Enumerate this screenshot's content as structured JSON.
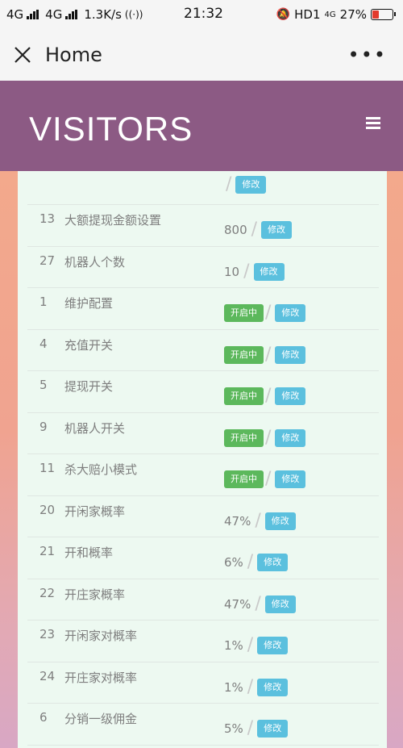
{
  "status": {
    "net1": "4G",
    "net2": "4G",
    "speed": "1.3K/s",
    "time": "21:32",
    "hd": "HD1",
    "net3": "4G",
    "battery": "27%",
    "battery_level": 0.27
  },
  "nav": {
    "title": "Home",
    "more": "•••"
  },
  "header": {
    "brand": "VISITORS"
  },
  "rows": [
    {
      "id": "",
      "name": "",
      "value": "",
      "status": "",
      "edit": "修改"
    },
    {
      "id": "13",
      "name": "大额提现金额设置",
      "value": "800",
      "status": "",
      "edit": "修改"
    },
    {
      "id": "27",
      "name": "机器人个数",
      "value": "10",
      "status": "",
      "edit": "修改"
    },
    {
      "id": "1",
      "name": "维护配置",
      "value": "",
      "status": "开启中",
      "edit": "修改"
    },
    {
      "id": "4",
      "name": "充值开关",
      "value": "",
      "status": "开启中",
      "edit": "修改"
    },
    {
      "id": "5",
      "name": "提现开关",
      "value": "",
      "status": "开启中",
      "edit": "修改"
    },
    {
      "id": "9",
      "name": "机器人开关",
      "value": "",
      "status": "开启中",
      "edit": "修改"
    },
    {
      "id": "11",
      "name": "杀大赔小模式",
      "value": "",
      "status": "开启中",
      "edit": "修改"
    },
    {
      "id": "20",
      "name": "开闲家概率",
      "value": "47%",
      "status": "",
      "edit": "修改"
    },
    {
      "id": "21",
      "name": "开和概率",
      "value": "6%",
      "status": "",
      "edit": "修改"
    },
    {
      "id": "22",
      "name": "开庄家概率",
      "value": "47%",
      "status": "",
      "edit": "修改"
    },
    {
      "id": "23",
      "name": "开闲家对概率",
      "value": "1%",
      "status": "",
      "edit": "修改"
    },
    {
      "id": "24",
      "name": "开庄家对概率",
      "value": "1%",
      "status": "",
      "edit": "修改"
    },
    {
      "id": "6",
      "name": "分销一级佣金",
      "value": "5%",
      "status": "",
      "edit": "修改"
    }
  ]
}
